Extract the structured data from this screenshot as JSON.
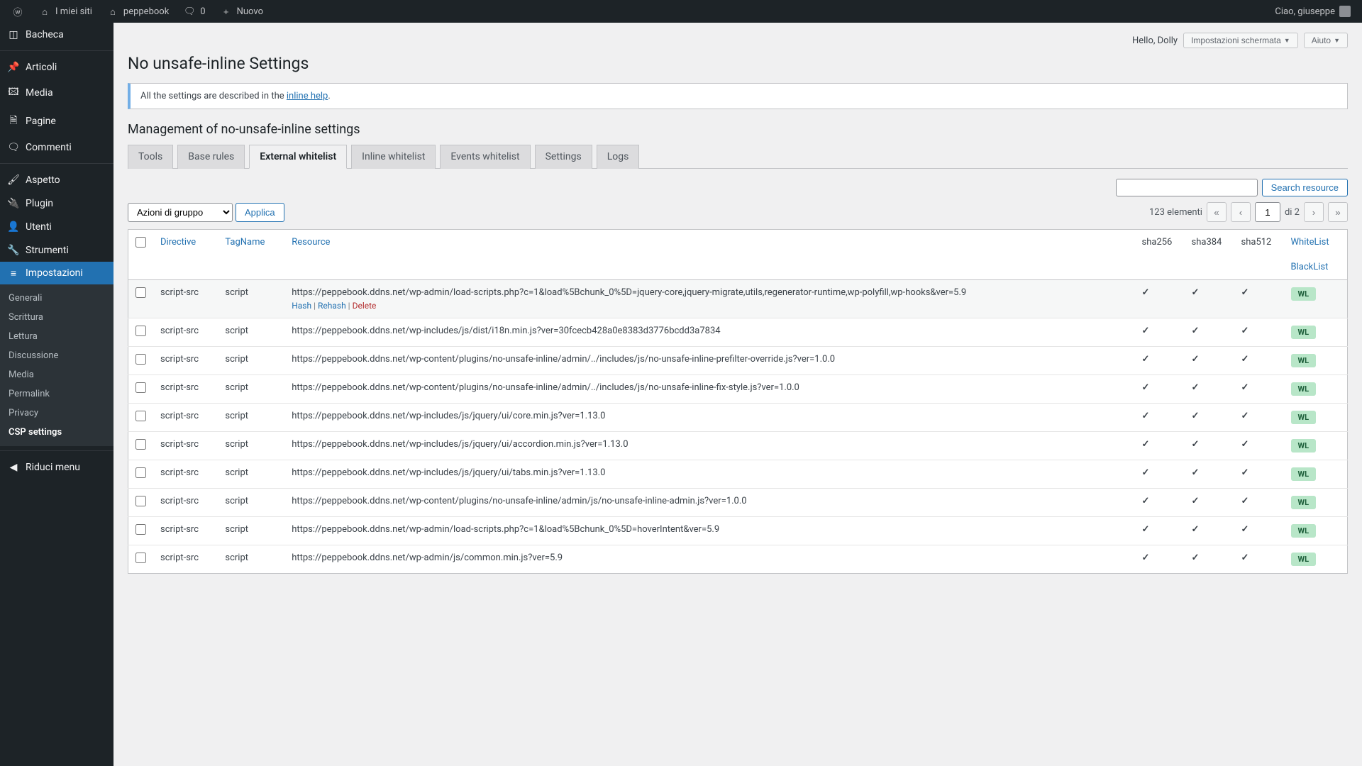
{
  "adminbar": {
    "my_sites": "I miei siti",
    "site_name": "peppebook",
    "comments": "0",
    "new": "Nuovo",
    "howdy": "Ciao, giuseppe"
  },
  "sidebar": {
    "items": [
      {
        "label": "Bacheca"
      },
      {
        "label": "Articoli"
      },
      {
        "label": "Media"
      },
      {
        "label": "Pagine"
      },
      {
        "label": "Commenti"
      },
      {
        "label": "Aspetto"
      },
      {
        "label": "Plugin"
      },
      {
        "label": "Utenti"
      },
      {
        "label": "Strumenti"
      },
      {
        "label": "Impostazioni"
      }
    ],
    "submenu": [
      {
        "label": "Generali"
      },
      {
        "label": "Scrittura"
      },
      {
        "label": "Lettura"
      },
      {
        "label": "Discussione"
      },
      {
        "label": "Media"
      },
      {
        "label": "Permalink"
      },
      {
        "label": "Privacy"
      },
      {
        "label": "CSP settings"
      }
    ],
    "collapse": "Riduci menu"
  },
  "topright": {
    "hello": "Hello, Dolly",
    "screen_options": "Impostazioni schermata",
    "help": "Aiuto"
  },
  "page": {
    "title": "No unsafe-inline Settings",
    "notice_pre": "All the settings are described in the ",
    "notice_link": "inline help",
    "section": "Management of no-unsafe-inline settings"
  },
  "tabs": [
    "Tools",
    "Base rules",
    "External whitelist",
    "Inline whitelist",
    "Events whitelist",
    "Settings",
    "Logs"
  ],
  "active_tab_index": 2,
  "search": {
    "button": "Search resource"
  },
  "bulk": {
    "select": "Azioni di gruppo",
    "apply": "Applica"
  },
  "pagination": {
    "count": "123 elementi",
    "page": "1",
    "of": "di 2"
  },
  "columns": {
    "directive": "Directive",
    "tagname": "TagName",
    "resource": "Resource",
    "sha256": "sha256",
    "sha384": "sha384",
    "sha512": "sha512",
    "whitelist": "WhiteList",
    "blacklist": "BlackList"
  },
  "row_actions": {
    "hash": "Hash",
    "rehash": "Rehash",
    "delete": "Delete"
  },
  "wl_badge": "WL",
  "rows": [
    {
      "directive": "script-src",
      "tag": "script",
      "resource": "https://peppebook.ddns.net/wp-admin/load-scripts.php?c=1&load%5Bchunk_0%5D=jquery-core,jquery-migrate,utils,regenerator-runtime,wp-polyfill,wp-hooks&ver=5.9",
      "hovered": true
    },
    {
      "directive": "script-src",
      "tag": "script",
      "resource": "https://peppebook.ddns.net/wp-includes/js/dist/i18n.min.js?ver=30fcecb428a0e8383d3776bcdd3a7834"
    },
    {
      "directive": "script-src",
      "tag": "script",
      "resource": "https://peppebook.ddns.net/wp-content/plugins/no-unsafe-inline/admin/../includes/js/no-unsafe-inline-prefilter-override.js?ver=1.0.0"
    },
    {
      "directive": "script-src",
      "tag": "script",
      "resource": "https://peppebook.ddns.net/wp-content/plugins/no-unsafe-inline/admin/../includes/js/no-unsafe-inline-fix-style.js?ver=1.0.0"
    },
    {
      "directive": "script-src",
      "tag": "script",
      "resource": "https://peppebook.ddns.net/wp-includes/js/jquery/ui/core.min.js?ver=1.13.0"
    },
    {
      "directive": "script-src",
      "tag": "script",
      "resource": "https://peppebook.ddns.net/wp-includes/js/jquery/ui/accordion.min.js?ver=1.13.0"
    },
    {
      "directive": "script-src",
      "tag": "script",
      "resource": "https://peppebook.ddns.net/wp-includes/js/jquery/ui/tabs.min.js?ver=1.13.0"
    },
    {
      "directive": "script-src",
      "tag": "script",
      "resource": "https://peppebook.ddns.net/wp-content/plugins/no-unsafe-inline/admin/js/no-unsafe-inline-admin.js?ver=1.0.0"
    },
    {
      "directive": "script-src",
      "tag": "script",
      "resource": "https://peppebook.ddns.net/wp-admin/load-scripts.php?c=1&load%5Bchunk_0%5D=hoverIntent&ver=5.9"
    },
    {
      "directive": "script-src",
      "tag": "script",
      "resource": "https://peppebook.ddns.net/wp-admin/js/common.min.js?ver=5.9"
    }
  ]
}
